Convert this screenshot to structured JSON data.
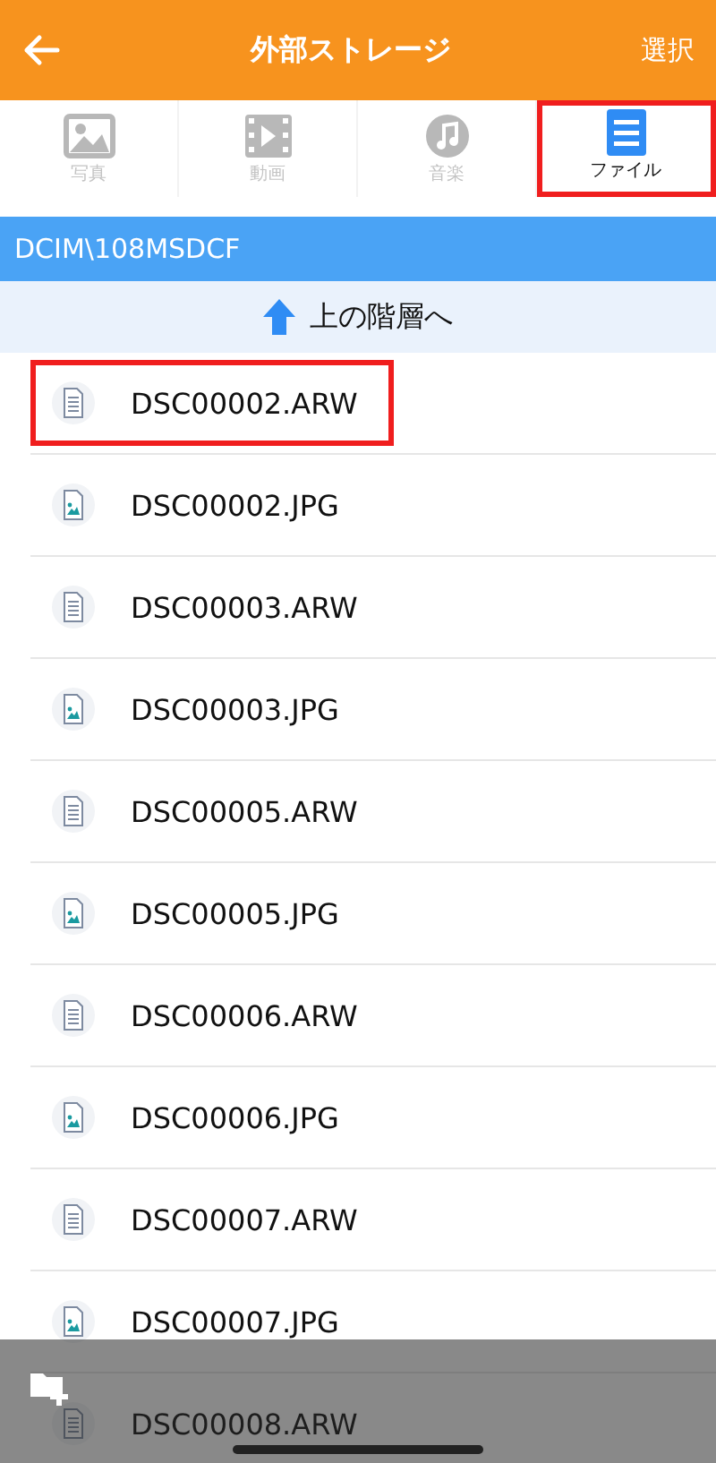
{
  "header": {
    "title": "外部ストレージ",
    "action": "選択"
  },
  "tabs": [
    {
      "label": "写真",
      "kind": "photo",
      "selected": false,
      "highlighted": false
    },
    {
      "label": "動画",
      "kind": "video",
      "selected": false,
      "highlighted": false
    },
    {
      "label": "音楽",
      "kind": "music",
      "selected": false,
      "highlighted": false
    },
    {
      "label": "ファイル",
      "kind": "file",
      "selected": true,
      "highlighted": true
    }
  ],
  "path": "DCIM\\108MSDCF",
  "up_link": "上の階層へ",
  "files": [
    {
      "name": "DSC00002.ARW",
      "kind": "raw",
      "highlighted": true
    },
    {
      "name": "DSC00002.JPG",
      "kind": "image",
      "highlighted": false
    },
    {
      "name": "DSC00003.ARW",
      "kind": "raw",
      "highlighted": false
    },
    {
      "name": "DSC00003.JPG",
      "kind": "image",
      "highlighted": false
    },
    {
      "name": "DSC00005.ARW",
      "kind": "raw",
      "highlighted": false
    },
    {
      "name": "DSC00005.JPG",
      "kind": "image",
      "highlighted": false
    },
    {
      "name": "DSC00006.ARW",
      "kind": "raw",
      "highlighted": false
    },
    {
      "name": "DSC00006.JPG",
      "kind": "image",
      "highlighted": false
    },
    {
      "name": "DSC00007.ARW",
      "kind": "raw",
      "highlighted": false
    },
    {
      "name": "DSC00007.JPG",
      "kind": "image",
      "highlighted": false
    },
    {
      "name": "DSC00008.ARW",
      "kind": "raw",
      "highlighted": false
    }
  ]
}
